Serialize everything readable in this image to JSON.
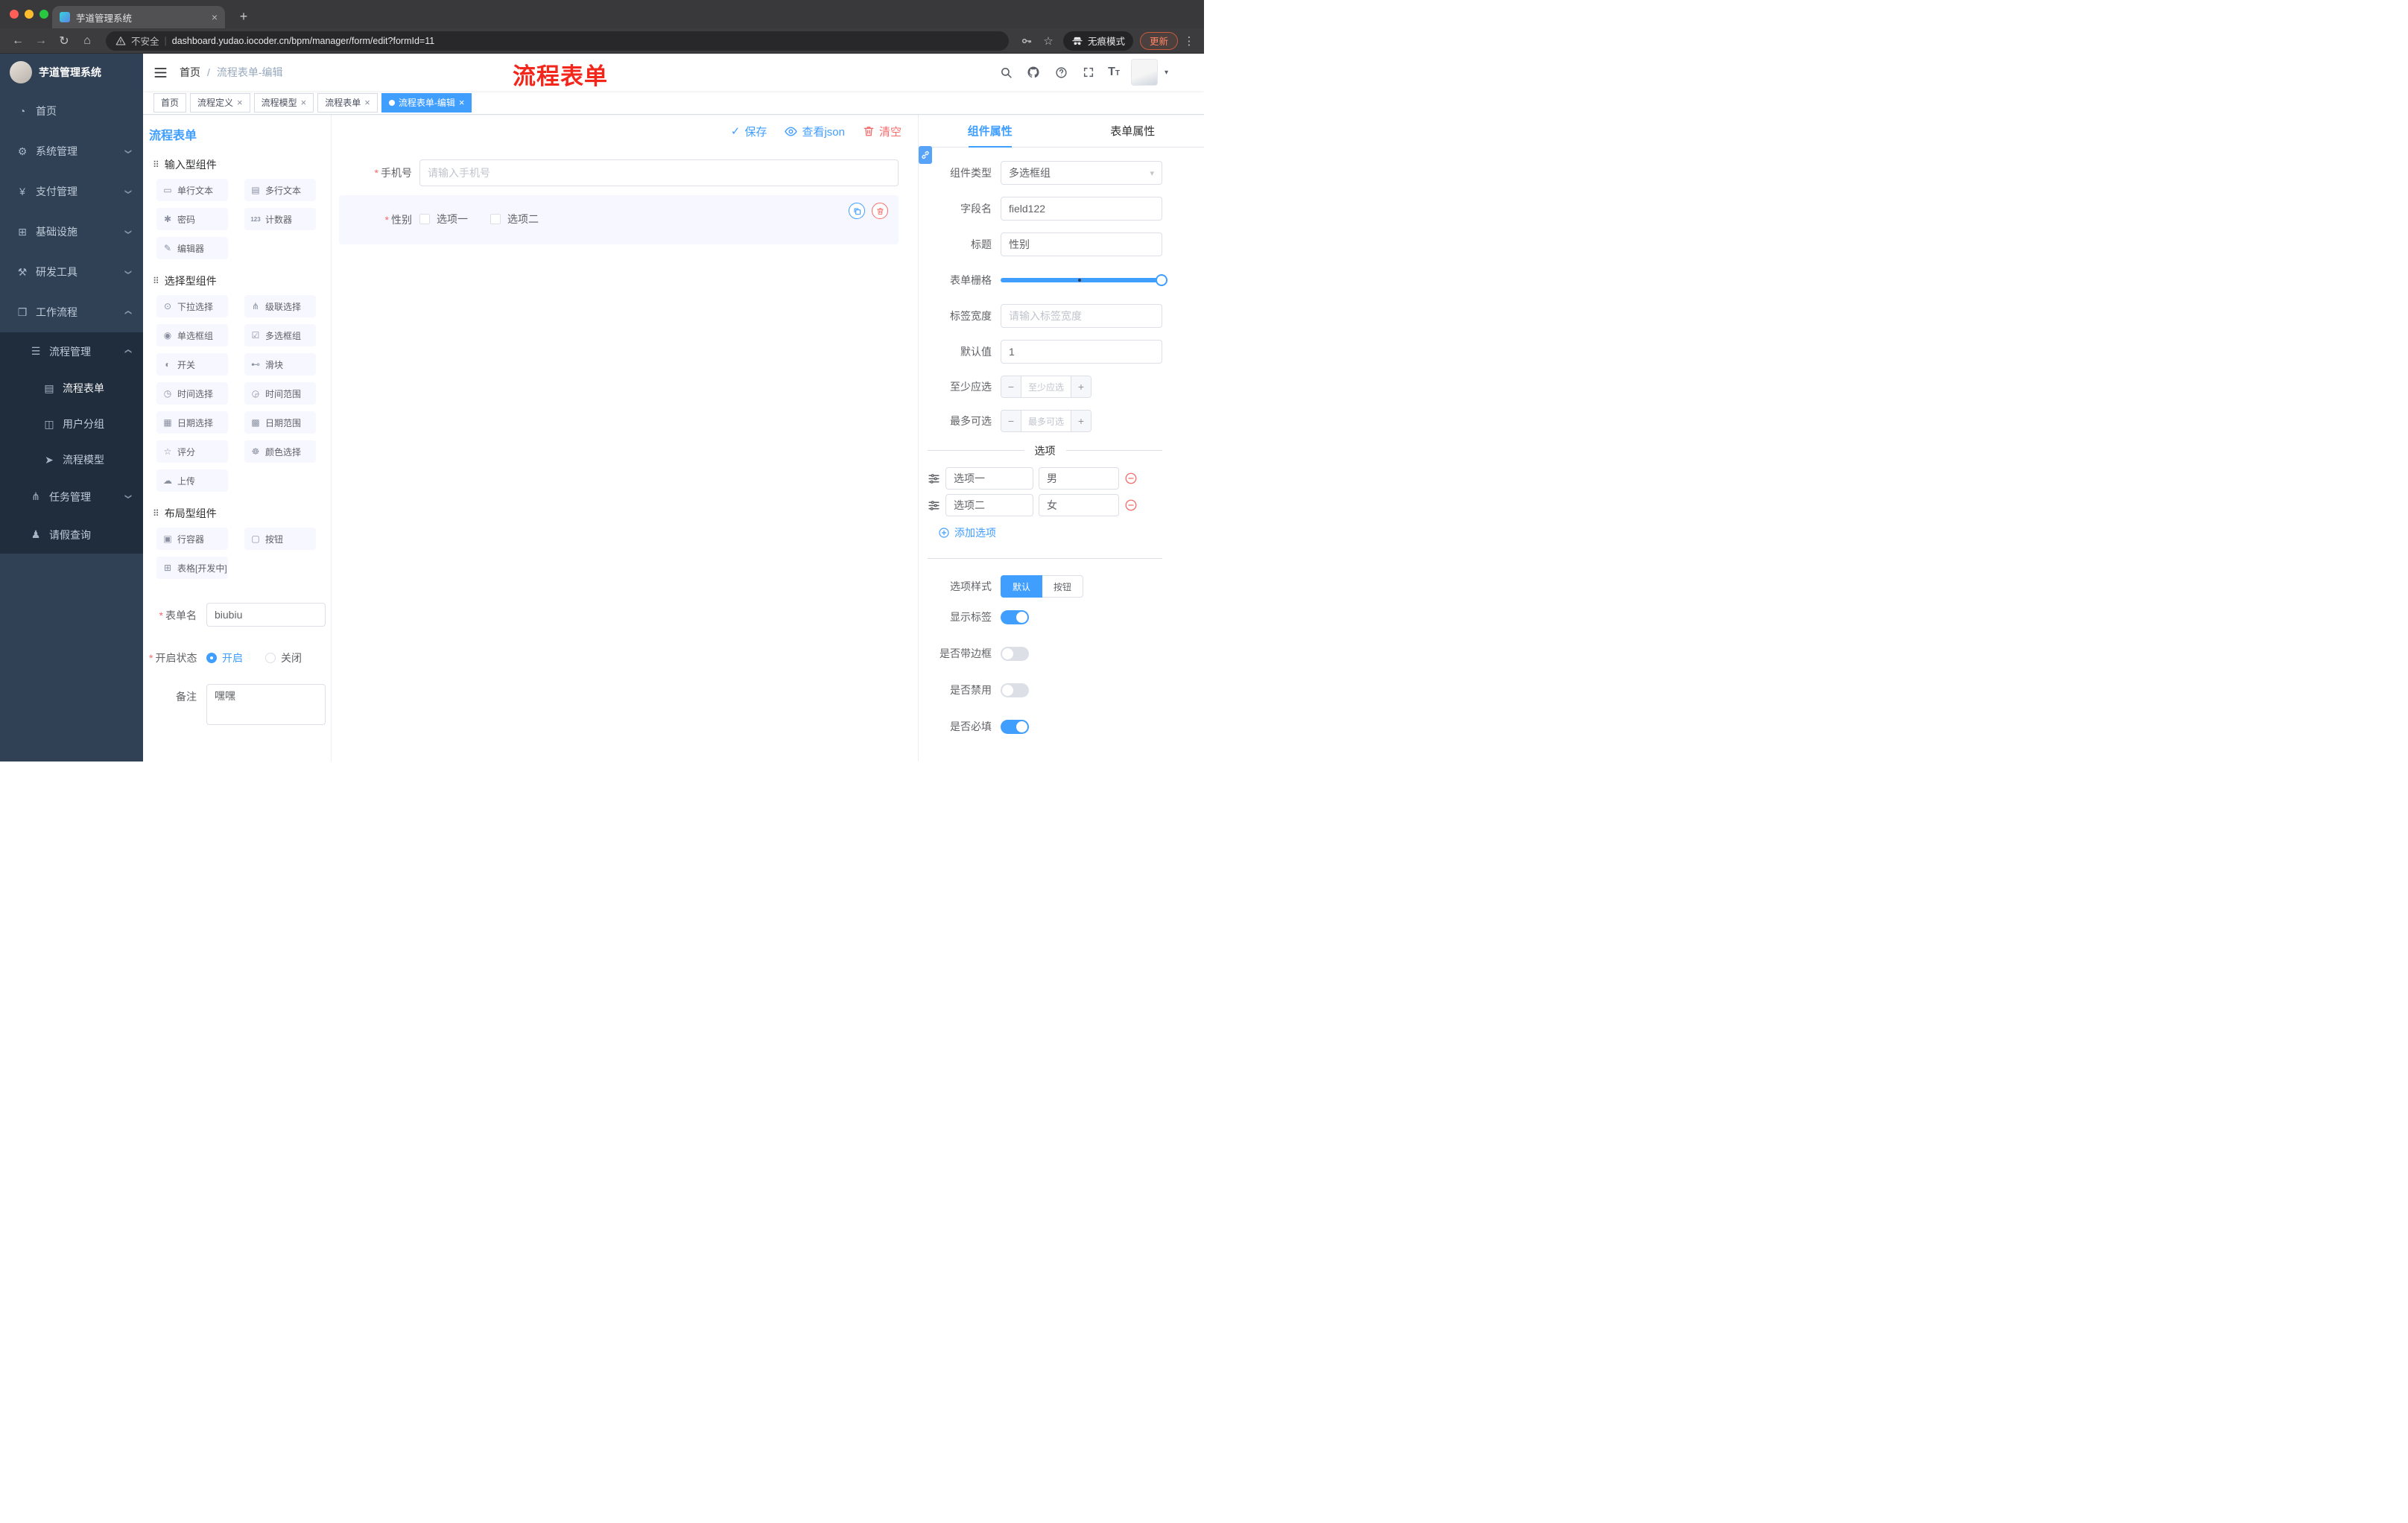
{
  "browser": {
    "tab_title": "芋道管理系统",
    "security_label": "不安全",
    "url": "dashboard.yudao.iocoder.cn/bpm/manager/form/edit?formId=11",
    "incognito_label": "无痕模式",
    "update_label": "更新"
  },
  "sidebar": {
    "logo_title": "芋道管理系统",
    "menu": [
      {
        "label": "首页",
        "icon": "dashboard-icon",
        "glyph": "◔"
      },
      {
        "label": "系统管理",
        "icon": "gear-icon",
        "glyph": "⚙",
        "chevron": "down"
      },
      {
        "label": "支付管理",
        "icon": "payment-icon",
        "glyph": "¥",
        "chevron": "down"
      },
      {
        "label": "基础设施",
        "icon": "infrastructure-icon",
        "glyph": "⊞",
        "chevron": "down"
      },
      {
        "label": "研发工具",
        "icon": "devtools-icon",
        "glyph": "⚒",
        "chevron": "down"
      },
      {
        "label": "工作流程",
        "icon": "workflow-icon",
        "glyph": "❒",
        "chevron": "up"
      }
    ],
    "submenu": [
      {
        "label": "流程管理",
        "icon": "process-manage-icon",
        "glyph": "☰",
        "chevron": "up",
        "level": 2
      },
      {
        "label": "流程表单",
        "icon": "process-form-icon",
        "glyph": "▤",
        "level": 3,
        "active": true
      },
      {
        "label": "用户分组",
        "icon": "user-group-icon",
        "glyph": "◫",
        "level": 3
      },
      {
        "label": "流程模型",
        "icon": "process-model-icon",
        "glyph": "➤",
        "level": 3
      },
      {
        "label": "任务管理",
        "icon": "task-manage-icon",
        "glyph": "⋔",
        "chevron": "down",
        "level": 2
      },
      {
        "label": "请假查询",
        "icon": "leave-query-icon",
        "glyph": "♟",
        "level": 2
      }
    ]
  },
  "navbar": {
    "breadcrumb": {
      "home": "首页",
      "separator": "/",
      "current": "流程表单-编辑"
    },
    "annotation": "流程表单"
  },
  "tags": [
    {
      "label": "首页",
      "closable": false,
      "active": false
    },
    {
      "label": "流程定义",
      "closable": true,
      "active": false
    },
    {
      "label": "流程模型",
      "closable": true,
      "active": false
    },
    {
      "label": "流程表单",
      "closable": true,
      "active": false
    },
    {
      "label": "流程表单-编辑",
      "closable": true,
      "active": true
    }
  ],
  "palette": {
    "title": "流程表单",
    "groups": [
      {
        "title": "输入型组件",
        "items": [
          {
            "label": "单行文本",
            "glyph": "▭",
            "icon": "single-line-text-icon"
          },
          {
            "label": "多行文本",
            "glyph": "▤",
            "icon": "multi-line-text-icon"
          },
          {
            "label": "密码",
            "glyph": "✱",
            "icon": "password-icon"
          },
          {
            "label": "计数器",
            "glyph": "123",
            "icon": "counter-icon"
          },
          {
            "label": "编辑器",
            "glyph": "✎",
            "icon": "editor-icon"
          }
        ]
      },
      {
        "title": "选择型组件",
        "items": [
          {
            "label": "下拉选择",
            "glyph": "⊙",
            "icon": "dropdown-select-icon"
          },
          {
            "label": "级联选择",
            "glyph": "⋔",
            "icon": "cascade-select-icon"
          },
          {
            "label": "单选框组",
            "glyph": "◉",
            "icon": "radio-group-icon"
          },
          {
            "label": "多选框组",
            "glyph": "☑",
            "icon": "checkbox-group-icon"
          },
          {
            "label": "开关",
            "glyph": "◐",
            "icon": "switch-icon"
          },
          {
            "label": "滑块",
            "glyph": "⊷",
            "icon": "slider-icon"
          },
          {
            "label": "时间选择",
            "glyph": "◷",
            "icon": "time-picker-icon"
          },
          {
            "label": "时间范围",
            "glyph": "◶",
            "icon": "time-range-icon"
          },
          {
            "label": "日期选择",
            "glyph": "▦",
            "icon": "date-picker-icon"
          },
          {
            "label": "日期范围",
            "glyph": "▩",
            "icon": "date-range-icon"
          },
          {
            "label": "评分",
            "glyph": "☆",
            "icon": "rate-icon"
          },
          {
            "label": "颜色选择",
            "glyph": "☸",
            "icon": "color-picker-icon"
          },
          {
            "label": "上传",
            "glyph": "☁",
            "icon": "upload-icon"
          }
        ]
      },
      {
        "title": "布局型组件",
        "items": [
          {
            "label": "行容器",
            "glyph": "▣",
            "icon": "row-container-icon"
          },
          {
            "label": "按钮",
            "glyph": "▢",
            "icon": "button-icon"
          },
          {
            "label": "表格[开发中]",
            "glyph": "⊞",
            "icon": "table-icon"
          }
        ]
      }
    ],
    "meta": {
      "name_label": "表单名",
      "name_value": "biubiu",
      "status_label": "开启状态",
      "status_options": [
        {
          "label": "开启",
          "selected": true
        },
        {
          "label": "关闭",
          "selected": false
        }
      ],
      "remark_label": "备注",
      "remark_value": "嘿嘿"
    }
  },
  "canvas": {
    "actions": [
      {
        "label": "保存",
        "icon": "check-icon",
        "type": "primary"
      },
      {
        "label": "查看json",
        "icon": "eye-icon",
        "type": "primary"
      },
      {
        "label": "清空",
        "icon": "trash-icon",
        "type": "danger"
      }
    ],
    "phone_field": {
      "label": "手机号",
      "placeholder": "请输入手机号"
    },
    "gender_field": {
      "label": "性别",
      "options": [
        "选项一",
        "选项二"
      ]
    }
  },
  "inspector": {
    "tabs": [
      {
        "label": "组件属性",
        "active": true
      },
      {
        "label": "表单属性",
        "active": false
      }
    ],
    "component_type": {
      "label": "组件类型",
      "value": "多选框组"
    },
    "field_name": {
      "label": "字段名",
      "value": "field122"
    },
    "title": {
      "label": "标题",
      "value": "性别"
    },
    "grid": {
      "label": "表单栅格",
      "value_percent": 100,
      "mark_percent": 48
    },
    "label_width": {
      "label": "标签宽度",
      "placeholder": "请输入标签宽度"
    },
    "default_value": {
      "label": "默认值",
      "value": "1"
    },
    "min_select": {
      "label": "至少应选",
      "placeholder": "至少应选"
    },
    "max_select": {
      "label": "最多可选",
      "placeholder": "最多可选"
    },
    "options_title": "选项",
    "options": [
      {
        "name": "选项一",
        "value": "男"
      },
      {
        "name": "选项二",
        "value": "女"
      }
    ],
    "add_option_label": "添加选项",
    "option_style": {
      "label": "选项样式",
      "choices": [
        {
          "label": "默认",
          "active": true
        },
        {
          "label": "按钮",
          "active": false
        }
      ]
    },
    "switches": [
      {
        "label": "显示标签",
        "on": true
      },
      {
        "label": "是否带边框",
        "on": false
      },
      {
        "label": "是否禁用",
        "on": false
      },
      {
        "label": "是否必填",
        "on": true
      }
    ]
  },
  "colors": {
    "primary": "#409EFF",
    "danger": "#F56C6C",
    "annotation_red": "#F3261C"
  }
}
